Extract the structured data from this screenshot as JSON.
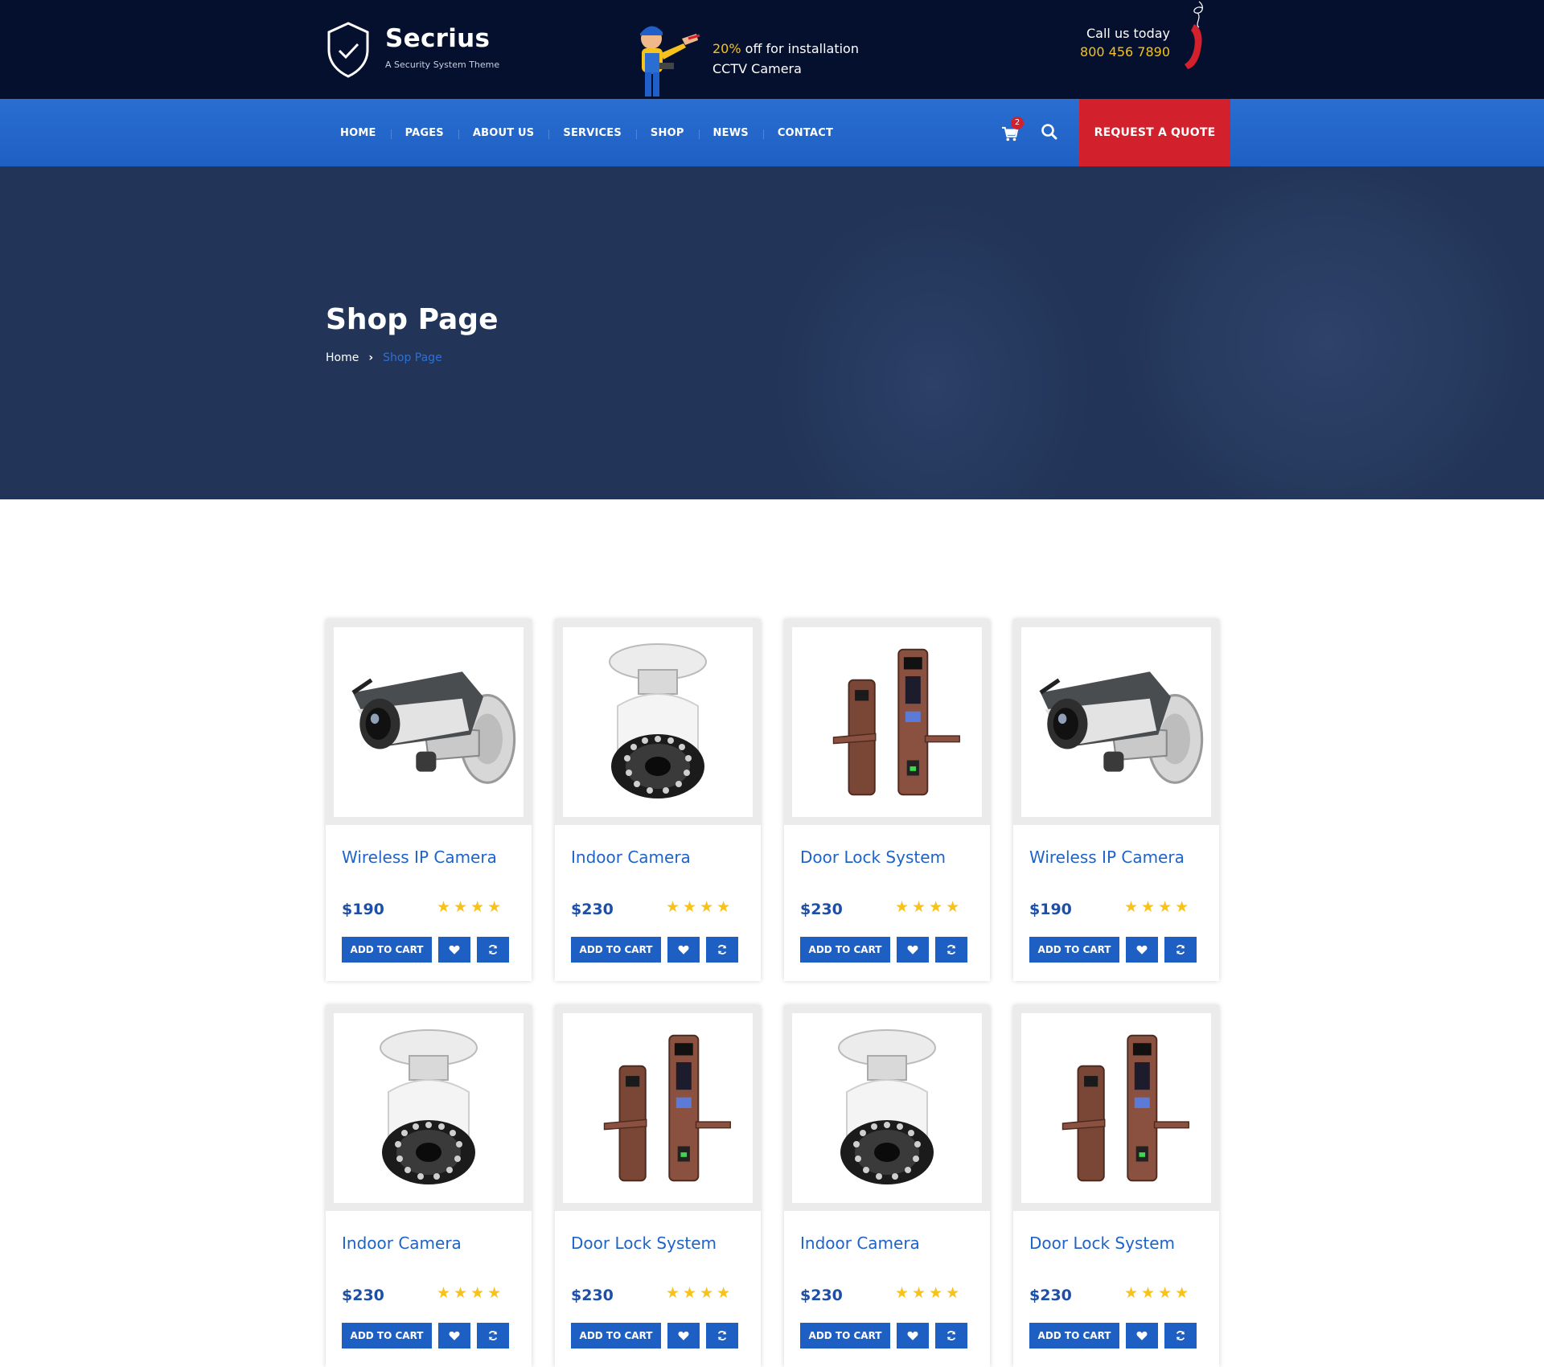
{
  "brand": {
    "name": "Secrius",
    "tagline": "A Security System Theme"
  },
  "promo": {
    "pct": "20%",
    "line1_rest": " off for installation",
    "line2": "CCTV Camera"
  },
  "contact": {
    "label": "Call us today",
    "phone": "800 456 7890"
  },
  "nav": {
    "items": [
      "HOME",
      "PAGES",
      "ABOUT US",
      "SERVICES",
      "SHOP",
      "NEWS",
      "CONTACT"
    ],
    "cart_count": "2",
    "quote_label": "REQUEST A QUOTE"
  },
  "hero": {
    "title": "Shop Page",
    "breadcrumb_home": "Home",
    "breadcrumb_current": "Shop Page"
  },
  "products": [
    {
      "name": "Wireless IP Camera",
      "price": "$190",
      "rating": 4,
      "image": "bullet-camera"
    },
    {
      "name": "Indoor Camera",
      "price": "$230",
      "rating": 4,
      "image": "dome-camera"
    },
    {
      "name": "Door Lock System",
      "price": "$230",
      "rating": 4,
      "image": "door-lock"
    },
    {
      "name": "Wireless IP Camera",
      "price": "$190",
      "rating": 4,
      "image": "bullet-camera"
    },
    {
      "name": "Indoor Camera",
      "price": "$230",
      "rating": 4,
      "image": "dome-camera"
    },
    {
      "name": "Door Lock System",
      "price": "$230",
      "rating": 4,
      "image": "door-lock"
    },
    {
      "name": "Indoor Camera",
      "price": "$230",
      "rating": 4,
      "image": "dome-camera"
    },
    {
      "name": "Door Lock System",
      "price": "$230",
      "rating": 4,
      "image": "door-lock"
    }
  ],
  "product_buttons": {
    "add_to_cart": "ADD TO CART",
    "wishlist_icon": "heart-icon",
    "compare_icon": "refresh-icon"
  },
  "colors": {
    "header_bg": "#050f2e",
    "nav_blue": "#1e5fc3",
    "quote_red": "#d2202c",
    "accent_yellow": "#f7c21b",
    "hero_bg": "#223558"
  }
}
